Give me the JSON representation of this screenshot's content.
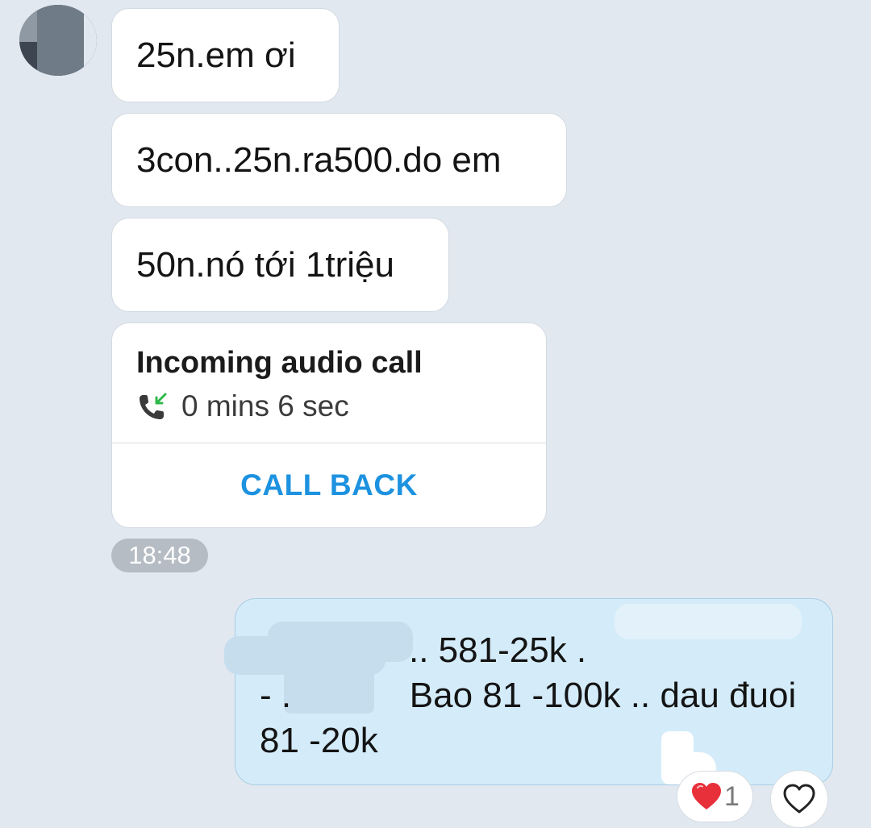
{
  "incoming_messages": [
    {
      "text": "25n.em ơi"
    },
    {
      "text": "3con..25n.ra500.do em"
    },
    {
      "text": "50n.nó tới 1triệu"
    }
  ],
  "call_card": {
    "title": "Incoming audio call",
    "duration": "0 mins 6 sec",
    "action_label": "CALL BACK",
    "icon": "incoming-call-icon",
    "accent_color": "#1d92e0",
    "arrow_color": "#2fb84a"
  },
  "timestamp": "18:48",
  "outgoing_message": {
    "lines": [
      ".. 581-25k .",
      "- .            Bao 81 -100k .. dau đuoi",
      "81 -20k"
    ]
  },
  "reaction": {
    "icon": "red-heart-icon",
    "count": "1",
    "add_reaction_icon": "heart-outline-icon"
  },
  "colors": {
    "background": "#e2e8f0",
    "incoming_bubble": "#ffffff",
    "outgoing_bubble": "#d4ecfa",
    "heart": "#e8303a"
  }
}
